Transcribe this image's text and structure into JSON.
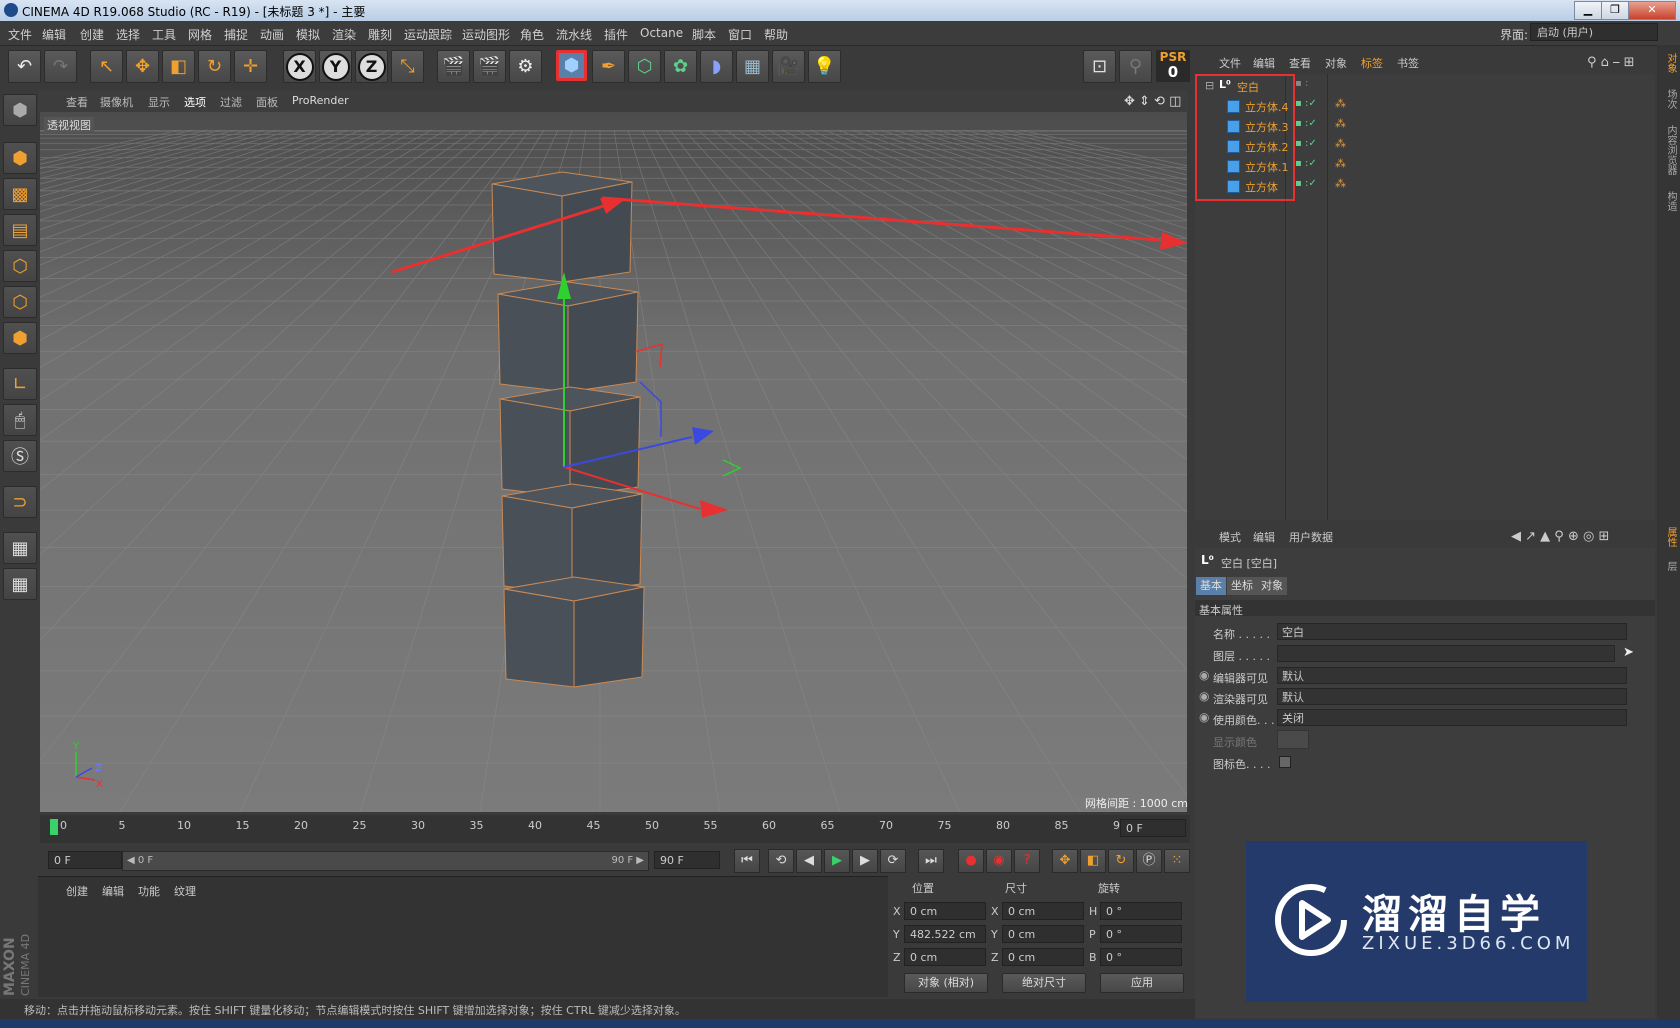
{
  "window": {
    "title": "CINEMA 4D R19.068 Studio (RC - R19) - [未标题 3 *] - 主要",
    "min": "▁",
    "max": "❐",
    "close": "✕"
  },
  "menubar": {
    "items": [
      "文件",
      "编辑",
      "创建",
      "选择",
      "工具",
      "网格",
      "捕捉",
      "动画",
      "模拟",
      "渲染",
      "雕刻",
      "运动跟踪",
      "运动图形",
      "角色",
      "流水线",
      "插件",
      "Octane",
      "脚本",
      "窗口",
      "帮助"
    ],
    "interface_label": "界面:",
    "interface_value": "启动 (用户)"
  },
  "toolbar": {
    "undo": "↶",
    "redo": "↷",
    "axis_x": "X",
    "axis_y": "Y",
    "axis_z": "Z",
    "psr_label": "PSR",
    "psr_value": "0"
  },
  "viewport": {
    "menu": [
      "查看",
      "摄像机",
      "显示",
      "选项",
      "过滤",
      "面板",
      "ProRender"
    ],
    "label": "透视视图",
    "grid_distance": "网格间距 : 1000 cm",
    "axis_y": "Y",
    "axis_z": "Z",
    "axis_x": "X"
  },
  "timeline": {
    "ticks": [
      "0",
      "5",
      "10",
      "15",
      "20",
      "25",
      "30",
      "35",
      "40",
      "45",
      "50",
      "55",
      "60",
      "65",
      "70",
      "75",
      "80",
      "85",
      "90"
    ],
    "current_frame": "0 F",
    "start_field": "0 F",
    "range_left": "◀ 0 F",
    "range_right": "90 F ▶",
    "end_field": "90 F"
  },
  "material_manager": {
    "menu": [
      "创建",
      "编辑",
      "功能",
      "纹理"
    ]
  },
  "coordinates": {
    "headers": [
      "位置",
      "尺寸",
      "旋转"
    ],
    "rows": [
      {
        "axis": "X",
        "pos": "0 cm",
        "size_axis": "X",
        "size": "0 cm",
        "rot_axis": "H",
        "rot": "0 °"
      },
      {
        "axis": "Y",
        "pos": "482.522 cm",
        "size_axis": "Y",
        "size": "0 cm",
        "rot_axis": "P",
        "rot": "0 °"
      },
      {
        "axis": "Z",
        "pos": "0 cm",
        "size_axis": "Z",
        "size": "0 cm",
        "rot_axis": "B",
        "rot": "0 °"
      }
    ],
    "mode_select": "对象 (相对)",
    "size_select": "绝对尺寸",
    "apply": "应用"
  },
  "status": "移动：点击并拖动鼠标移动元素。按住 SHIFT 键量化移动；节点编辑模式时按住 SHIFT 键增加选择对象；按住 CTRL 键减少选择对象。",
  "logo": {
    "line1": "MAXON",
    "line2": "CINEMA 4D"
  },
  "object_manager": {
    "menu": [
      "文件",
      "编辑",
      "查看",
      "对象",
      "标签",
      "书签"
    ],
    "root": "空白",
    "children": [
      "立方体.4",
      "立方体.3",
      "立方体.2",
      "立方体.1",
      "立方体"
    ]
  },
  "attribute_manager": {
    "menu": [
      "模式",
      "编辑",
      "用户数据"
    ],
    "object_title": "空白 [空白]",
    "tabs": [
      "基本",
      "坐标",
      "对象"
    ],
    "section": "基本属性",
    "fields": {
      "name_label": "名称 . . . . .",
      "name_value": "空白",
      "layer_label": "图层 . . . . .",
      "editor_visible_label": "编辑器可见",
      "editor_visible_value": "默认",
      "render_visible_label": "渲染器可见",
      "render_visible_value": "默认",
      "use_color_label": "使用颜色. . .",
      "use_color_value": "关闭",
      "display_color_label": "显示颜色",
      "icon_color_label": "图标色. . . ."
    }
  },
  "side_tabs": [
    "对象",
    "场次",
    "内容浏览器",
    "构造",
    "属性",
    "层"
  ],
  "watermark": {
    "main": "溜溜自学",
    "sub": "ZIXUE.3D66.COM"
  },
  "colors": {
    "accent": "#f0a030",
    "highlight_red": "#e83030",
    "selected_blue": "#4aa0e8",
    "watermark_bg": "#233a6b"
  }
}
